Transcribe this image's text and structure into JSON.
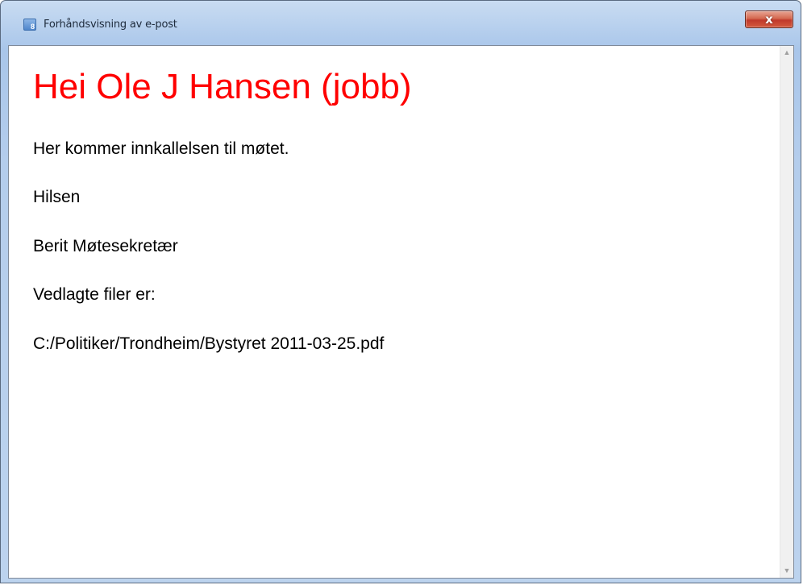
{
  "window": {
    "title": "Forhåndsvisning av e-post",
    "app_icon_glyph": "8",
    "close_glyph": "x"
  },
  "email": {
    "greeting": "Hei Ole J Hansen (jobb)",
    "body_line": "Her kommer innkallelsen til møtet.",
    "closing": "Hilsen",
    "sender": "Berit Møtesekretær",
    "attachments_label": "Vedlagte filer er:",
    "attachment_path": "C:/Politiker/Trondheim/Bystyret 2011-03-25.pdf"
  },
  "scrollbar": {
    "up_icon": "scroll-up-arrow-icon",
    "down_icon": "scroll-down-arrow-icon"
  },
  "colors": {
    "greeting": "#ff0000",
    "close_button": "#c0392b",
    "window_frame": "#b9d1ee"
  }
}
